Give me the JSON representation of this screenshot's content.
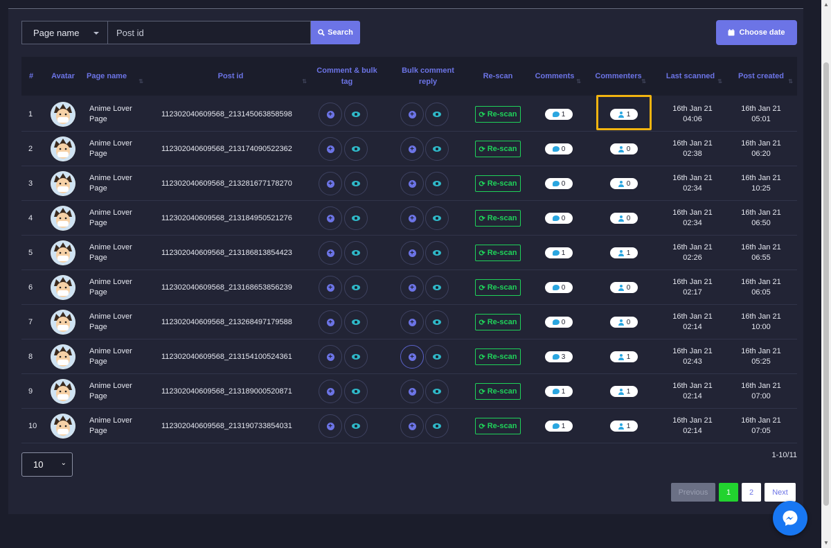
{
  "filter": {
    "page_select_value": "Page name",
    "post_placeholder": "Post id",
    "search_label": "Search",
    "date_label": "Choose date"
  },
  "columns": [
    "#",
    "Avatar",
    "Page name",
    "Post id",
    "Comment & bulk tag",
    "Bulk comment reply",
    "Re-scan",
    "Comments",
    "Commenters",
    "Last scanned",
    "Post created"
  ],
  "rows": [
    {
      "num": "1",
      "page": "Anime Lover Page",
      "post": "112302040609568_213145063858598",
      "rescan": "Re-scan",
      "comments": "1",
      "commenters": "1",
      "scan_date": "16th Jan 21",
      "scan_time": "04:06",
      "created_date": "16th Jan 21",
      "created_time": "05:01"
    },
    {
      "num": "2",
      "page": "Anime Lover Page",
      "post": "112302040609568_213174090522362",
      "rescan": "Re-scan",
      "comments": "0",
      "commenters": "0",
      "scan_date": "16th Jan 21",
      "scan_time": "02:38",
      "created_date": "16th Jan 21",
      "created_time": "06:20"
    },
    {
      "num": "3",
      "page": "Anime Lover Page",
      "post": "112302040609568_213281677178270",
      "rescan": "Re-scan",
      "comments": "0",
      "commenters": "0",
      "scan_date": "16th Jan 21",
      "scan_time": "02:34",
      "created_date": "16th Jan 21",
      "created_time": "10:25"
    },
    {
      "num": "4",
      "page": "Anime Lover Page",
      "post": "112302040609568_213184950521276",
      "rescan": "Re-scan",
      "comments": "0",
      "commenters": "0",
      "scan_date": "16th Jan 21",
      "scan_time": "02:34",
      "created_date": "16th Jan 21",
      "created_time": "06:50"
    },
    {
      "num": "5",
      "page": "Anime Lover Page",
      "post": "112302040609568_213186813854423",
      "rescan": "Re-scan",
      "comments": "1",
      "commenters": "1",
      "scan_date": "16th Jan 21",
      "scan_time": "02:26",
      "created_date": "16th Jan 21",
      "created_time": "06:55"
    },
    {
      "num": "6",
      "page": "Anime Lover Page",
      "post": "112302040609568_213168653856239",
      "rescan": "Re-scan",
      "comments": "0",
      "commenters": "0",
      "scan_date": "16th Jan 21",
      "scan_time": "02:17",
      "created_date": "16th Jan 21",
      "created_time": "06:05"
    },
    {
      "num": "7",
      "page": "Anime Lover Page",
      "post": "112302040609568_213268497179588",
      "rescan": "Re-scan",
      "comments": "0",
      "commenters": "0",
      "scan_date": "16th Jan 21",
      "scan_time": "02:14",
      "created_date": "16th Jan 21",
      "created_time": "10:00"
    },
    {
      "num": "8",
      "page": "Anime Lover Page",
      "post": "112302040609568_213154100524361",
      "rescan": "Re-scan",
      "comments": "3",
      "commenters": "1",
      "scan_date": "16th Jan 21",
      "scan_time": "02:43",
      "created_date": "16th Jan 21",
      "created_time": "05:25"
    },
    {
      "num": "9",
      "page": "Anime Lover Page",
      "post": "112302040609568_213189000520871",
      "rescan": "Re-scan",
      "comments": "1",
      "commenters": "1",
      "scan_date": "16th Jan 21",
      "scan_time": "02:14",
      "created_date": "16th Jan 21",
      "created_time": "07:00"
    },
    {
      "num": "10",
      "page": "Anime Lover Page",
      "post": "112302040609568_213190733854031",
      "rescan": "Re-scan",
      "comments": "1",
      "commenters": "1",
      "scan_date": "16th Jan 21",
      "scan_time": "02:14",
      "created_date": "16th Jan 21",
      "created_time": "07:05"
    }
  ],
  "footer": {
    "per_page": "10",
    "range": "1-10/11",
    "prev": "Previous",
    "page1": "1",
    "page2": "2",
    "next": "Next"
  },
  "colors": {
    "accent": "#6c74e6",
    "rescan": "#1fd35a",
    "active_page": "#22d32f",
    "highlight": "#f2b410"
  }
}
